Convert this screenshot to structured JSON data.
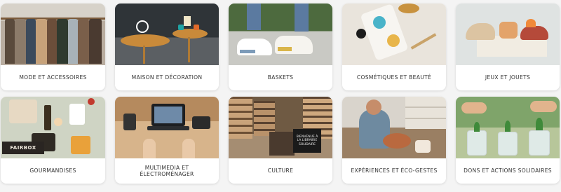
{
  "categories": [
    {
      "label": "MODE ET ACCESSOIRES"
    },
    {
      "label": "MAISON ET DÉCORATION"
    },
    {
      "label": "BASKETS"
    },
    {
      "label": "COSMÉTIQUES ET BEAUTÉ"
    },
    {
      "label": "JEUX ET JOUETS"
    },
    {
      "label": "GOURMANDISES"
    },
    {
      "label_line1": "MULTIMEDIA ET",
      "label_line2": "ÉLECTROMÉNAGER"
    },
    {
      "label": "CULTURE"
    },
    {
      "label": "EXPÉRIENCES ET ÉCO-GESTES"
    },
    {
      "label": "DONS ET ACTIONS SOLIDAIRES"
    }
  ],
  "image_text": {
    "gourmandises_box": "FAIRBOX",
    "culture_sign": "BIENVENUE À LA LIBRAIRIE SOLIDAIRE"
  }
}
